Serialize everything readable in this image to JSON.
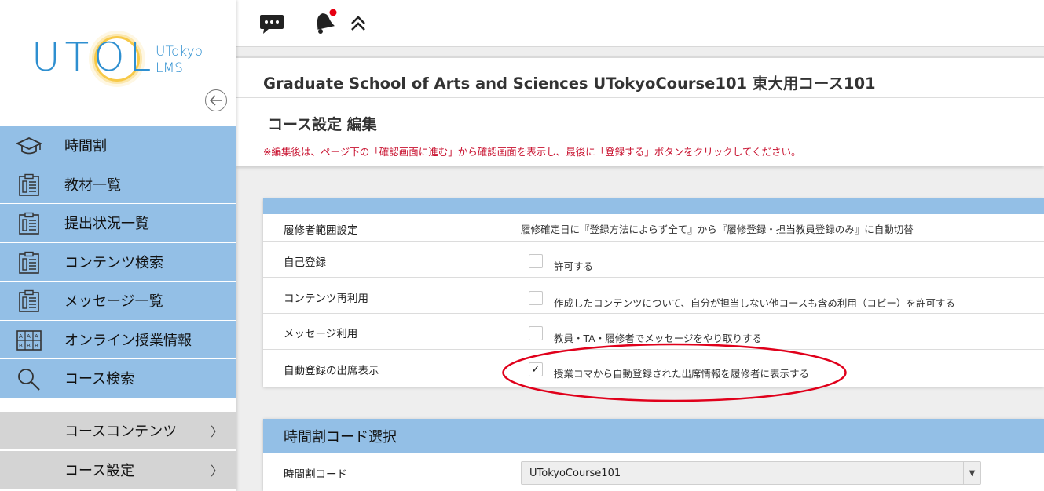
{
  "sidebar": {
    "logo": {
      "main": "UTOL",
      "sub_line1": "UTokyo",
      "sub_line2": "LMS"
    },
    "collapse_icon": "arrow-left-circle-icon",
    "nav_items": [
      {
        "label": "時間割",
        "icon": "mortarboard-icon"
      },
      {
        "label": "教材一覧",
        "icon": "clipboard-list-icon"
      },
      {
        "label": "提出状況一覧",
        "icon": "clipboard-list-icon"
      },
      {
        "label": "コンテンツ検索",
        "icon": "clipboard-list-icon"
      },
      {
        "label": "メッセージ一覧",
        "icon": "clipboard-list-icon"
      },
      {
        "label": "オンライン授業情報",
        "icon": "grid-calendar-icon"
      },
      {
        "label": "コース検索",
        "icon": "magnifier-icon"
      }
    ],
    "sub_items": [
      {
        "label": "コースコンテンツ",
        "chevron": "〉"
      },
      {
        "label": "コース設定",
        "chevron": "〉"
      }
    ]
  },
  "topbar": {
    "icons": [
      "chat-bubble-icon",
      "bell-icon",
      "double-chevron-up-icon"
    ],
    "notification_dot_color": "#e60012"
  },
  "header": {
    "course_title": "Graduate School of Arts and Sciences UTokyoCourse101 東大用コース101",
    "page_title": "コース設定 編集",
    "notice": "※編集後は、ページ下の「確認画面に進む」から確認画面を表示し、最後に「登録する」ボタンをクリックしてください。"
  },
  "settings": {
    "rows": [
      {
        "label": "履修者範囲設定",
        "value": "履修確定日に『登録方法によらず全て』から『履修登録・担当教員登録のみ』に自動切替"
      },
      {
        "label": "自己登録",
        "checkbox_label": "許可する",
        "checked": false
      },
      {
        "label": "コンテンツ再利用",
        "checkbox_label": "作成したコンテンツについて、自分が担当しない他コースも含め利用（コピー）を許可する",
        "checked": false
      },
      {
        "label": "メッセージ利用",
        "checkbox_label": "教員・TA・履修者でメッセージをやり取りする",
        "checked": false
      },
      {
        "label": "自動登録の出席表示",
        "checkbox_label": "授業コマから自動登録された出席情報を履修者に表示する",
        "checked": true
      }
    ],
    "checkmark": "✓"
  },
  "timecode": {
    "section_title": "時間割コード選択",
    "label": "時間割コード",
    "selected": "UTokyoCourse101",
    "arrow": "▼"
  },
  "colors": {
    "nav_blue": "#93bfe6",
    "sub_gray": "#d4d4d4",
    "logo_blue": "#2e8fd0",
    "logo_sun": "#f7c948",
    "notice_red": "#c8102e",
    "annotation_red": "#e0001b"
  }
}
